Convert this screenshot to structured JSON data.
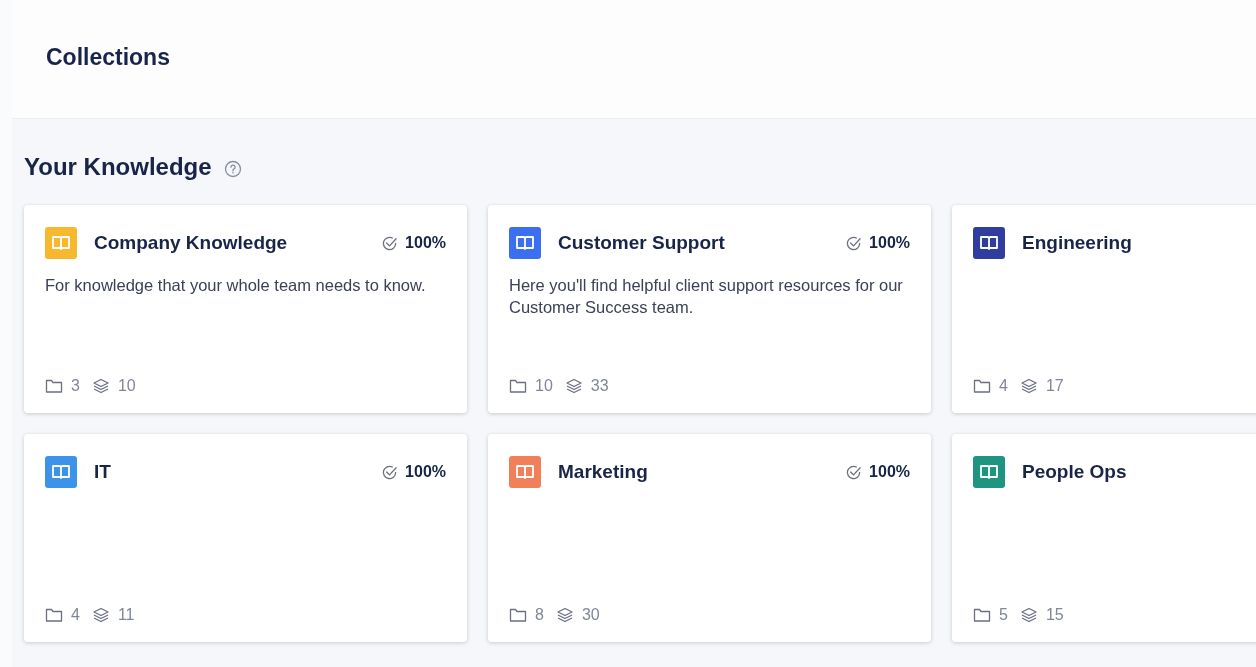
{
  "header": {
    "title": "Collections"
  },
  "section": {
    "title": "Your Knowledge"
  },
  "collections": [
    {
      "name": "Company Knowledge",
      "color": "#f5b82e",
      "verification": "100%",
      "description": "For knowledge that your whole team needs to know.",
      "folders": "3",
      "cards": "10"
    },
    {
      "name": "Customer Support",
      "color": "#3b6ff0",
      "verification": "100%",
      "description": "Here you'll find helpful client support resources for our Customer Success team.",
      "folders": "10",
      "cards": "33"
    },
    {
      "name": "Engineering",
      "color": "#2f3d9e",
      "folders": "4",
      "cards": "17"
    },
    {
      "name": "IT",
      "color": "#3d93e8",
      "verification": "100%",
      "folders": "4",
      "cards": "11"
    },
    {
      "name": "Marketing",
      "color": "#f0805a",
      "verification": "100%",
      "folders": "8",
      "cards": "30"
    },
    {
      "name": "People Ops",
      "color": "#1f9481",
      "folders": "5",
      "cards": "15"
    }
  ]
}
